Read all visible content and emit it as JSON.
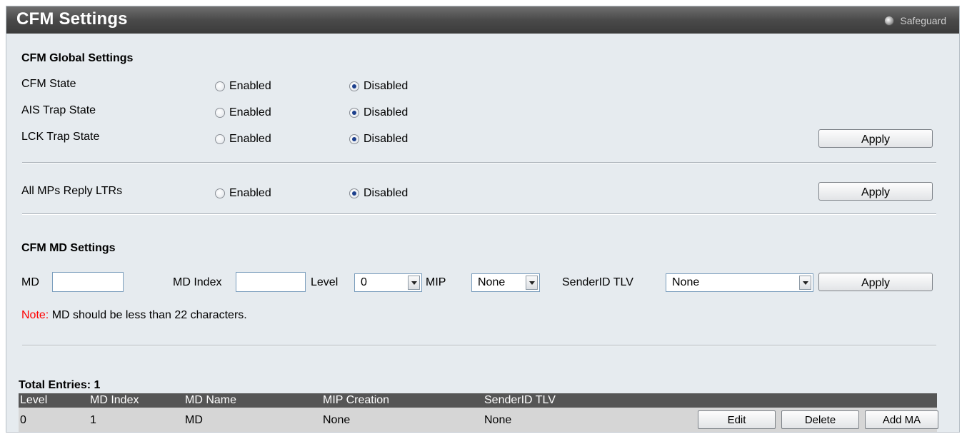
{
  "header": {
    "title": "CFM Settings",
    "safeguard_label": "Safeguard"
  },
  "global": {
    "section_title": "CFM Global Settings",
    "rows": [
      {
        "label": "CFM State",
        "enabled": "Enabled",
        "disabled": "Disabled",
        "selected": "Disabled"
      },
      {
        "label": "AIS Trap State",
        "enabled": "Enabled",
        "disabled": "Disabled",
        "selected": "Disabled"
      },
      {
        "label": "LCK Trap State",
        "enabled": "Enabled",
        "disabled": "Disabled",
        "selected": "Disabled"
      }
    ],
    "apply_label": "Apply"
  },
  "ltr": {
    "label": "All MPs Reply LTRs",
    "enabled": "Enabled",
    "disabled": "Disabled",
    "selected": "Disabled",
    "apply_label": "Apply"
  },
  "md": {
    "section_title": "CFM MD Settings",
    "md_label": "MD",
    "md_value": "",
    "md_index_label": "MD Index",
    "md_index_value": "",
    "level_label": "Level",
    "level_value": "0",
    "mip_label": "MIP",
    "mip_value": "None",
    "senderid_label": "SenderID TLV",
    "senderid_value": "None",
    "apply_label": "Apply",
    "note_prefix": "Note:",
    "note_text": " MD should be less than 22 characters."
  },
  "table": {
    "total_label": "Total Entries: 1",
    "columns": [
      "Level",
      "MD Index",
      "MD Name",
      "MIP Creation",
      "SenderID TLV"
    ],
    "rows": [
      {
        "level": "0",
        "md_index": "1",
        "md_name": "MD",
        "mip_creation": "None",
        "senderid_tlv": "None"
      }
    ],
    "edit_label": "Edit",
    "delete_label": "Delete",
    "add_ma_label": "Add MA"
  },
  "colors": {
    "title_bar": "#4a4a4a",
    "panel_bg": "#e6ebef",
    "note_red": "#ff0000",
    "table_head": "#555555"
  }
}
